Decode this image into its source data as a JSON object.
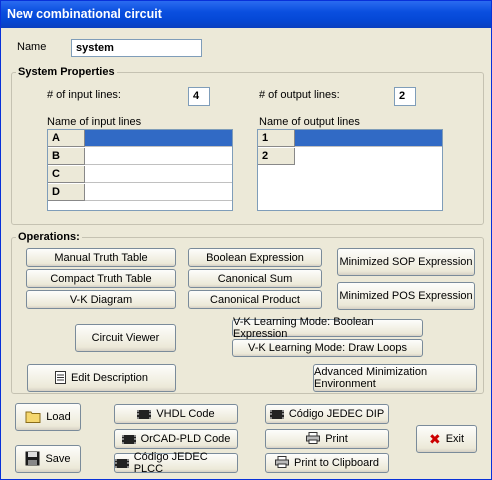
{
  "window": {
    "title": "New combinational circuit"
  },
  "name": {
    "label": "Name",
    "value": "system"
  },
  "system_properties": {
    "title": "System Properties",
    "input_lines_label": "# of input lines:",
    "input_lines_value": "4",
    "output_lines_label": "# of output lines:",
    "output_lines_value": "2",
    "input_names_label": "Name of input lines",
    "output_names_label": "Name of output lines",
    "inputs": [
      "A",
      "B",
      "C",
      "D"
    ],
    "outputs": [
      "1",
      "2"
    ]
  },
  "operations": {
    "title": "Operations:",
    "manual_truth_table": "Manual Truth Table",
    "compact_truth_table": "Compact Truth Table",
    "vk_diagram": "V-K Diagram",
    "boolean_expression": "Boolean Expression",
    "canonical_sum": "Canonical Sum",
    "canonical_product": "Canonical Product",
    "minimized_sop": "Minimized SOP Expression",
    "minimized_pos": "Minimized POS Expression",
    "circuit_viewer": "Circuit Viewer",
    "vk_learning_boolean": "V-K Learning Mode: Boolean Expression",
    "vk_learning_loops": "V-K Learning Mode: Draw Loops",
    "edit_description": "Edit Description",
    "advanced_minimization": "Advanced Minimization Environment"
  },
  "bottom": {
    "load": "Load",
    "save": "Save",
    "vhdl": "VHDL Code",
    "orcad": "OrCAD-PLD Code",
    "jedec_plcc": "Código JEDEC PLCC",
    "jedec_dip": "Código JEDEC DIP",
    "print": "Print",
    "print_clipboard": "Print to Clipboard",
    "exit": "Exit"
  }
}
